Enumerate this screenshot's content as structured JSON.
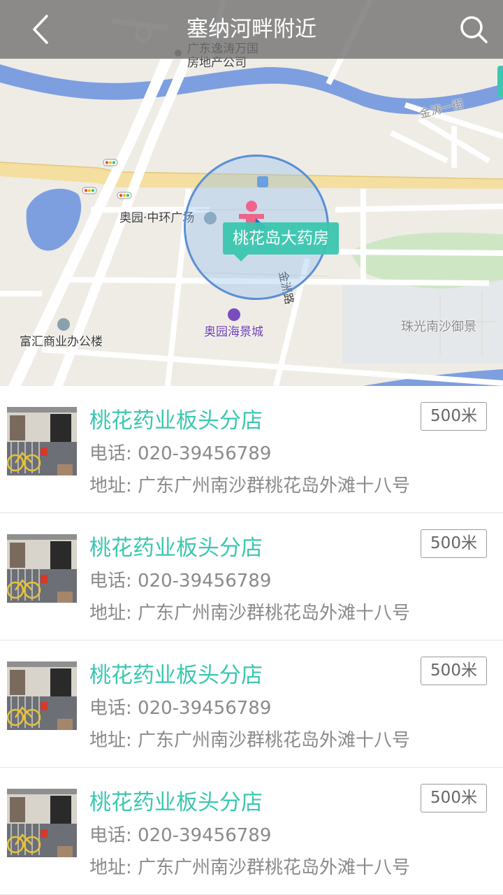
{
  "header": {
    "title": "塞纳河畔附近"
  },
  "map": {
    "labels": {
      "top_company": "广东逸涛万国\n房地产公司",
      "street_right": "金涛一街",
      "plaza": "奥园·中环广场",
      "road_vertical": "金洲路",
      "mall": "奥园海景城",
      "office": "富汇商业办公楼",
      "estate": "珠光南沙御景"
    },
    "callout": "桃花岛大药房"
  },
  "stores": [
    {
      "name": "桃花药业板头分店",
      "phone": "电话: 020-39456789",
      "address": "地址: 广东广州南沙群桃花岛外滩十八号",
      "distance": "500米"
    },
    {
      "name": "桃花药业板头分店",
      "phone": "电话: 020-39456789",
      "address": "地址: 广东广州南沙群桃花岛外滩十八号",
      "distance": "500米"
    },
    {
      "name": "桃花药业板头分店",
      "phone": "电话: 020-39456789",
      "address": "地址: 广东广州南沙群桃花岛外滩十八号",
      "distance": "500米"
    },
    {
      "name": "桃花药业板头分店",
      "phone": "电话: 020-39456789",
      "address": "地址: 广东广州南沙群桃花岛外滩十八号",
      "distance": "500米"
    }
  ],
  "colors": {
    "accent": "#3bc7b0",
    "river": "#7d9fe0",
    "header_bg": "#6e6e6e"
  }
}
